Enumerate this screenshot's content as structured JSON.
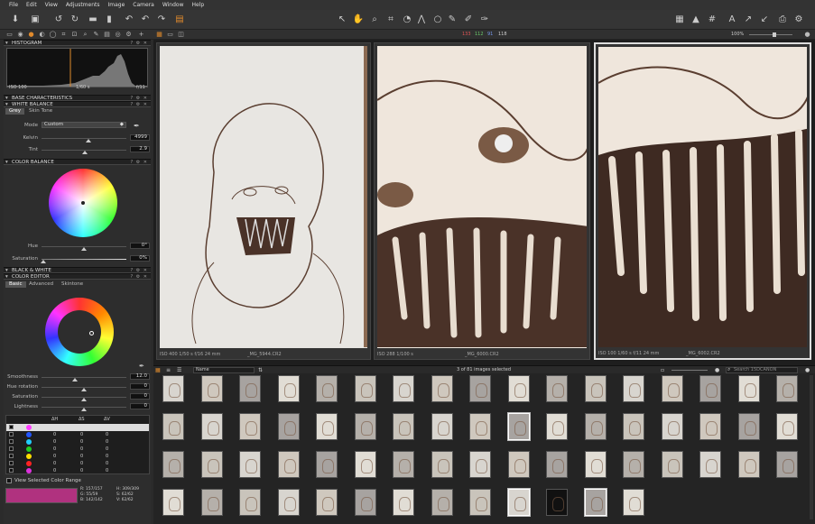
{
  "menu": [
    "File",
    "Edit",
    "View",
    "Adjustments",
    "Image",
    "Camera",
    "Window",
    "Help"
  ],
  "toolstrip": {
    "rgb": [
      "133",
      "112",
      "91",
      "118"
    ],
    "zoom": "100%"
  },
  "histogram": {
    "title": "HISTOGRAM",
    "iso": "ISO 100",
    "shutter": "1/60 s",
    "aperture": "f/11"
  },
  "sections": {
    "base": "BASE CHARACTERISTICS",
    "wb": "WHITE BALANCE",
    "colorbalance": "COLOR BALANCE",
    "bw": "BLACK & WHITE",
    "coloreditor": "COLOR EDITOR"
  },
  "wb": {
    "tabs": [
      "Grey",
      "Skin Tone"
    ],
    "mode_label": "Mode",
    "mode_value": "Custom",
    "kelvin_label": "Kelvin",
    "kelvin_value": "4999",
    "tint_label": "Tint",
    "tint_value": "2.9"
  },
  "colorbalance": {
    "hue_label": "Hue",
    "hue_value": "0°",
    "sat_label": "Saturation",
    "sat_value": "0%"
  },
  "coloreditor": {
    "tabs": [
      "Basic",
      "Advanced",
      "Skintone"
    ],
    "smoothness_label": "Smoothness",
    "smoothness_value": "12.0",
    "huerot_label": "Hue rotation",
    "huerot_value": "0",
    "sat_label": "Saturation",
    "sat_value": "0",
    "light_label": "Lightness",
    "light_value": "0",
    "table_headers": [
      "ΔH",
      "ΔS",
      "ΔV"
    ],
    "rows": [
      {
        "color": "#ff3cff",
        "h": "",
        "s": "",
        "v": ""
      },
      {
        "color": "#2255ff",
        "h": "0",
        "s": "0",
        "v": "0"
      },
      {
        "color": "#22ccff",
        "h": "0",
        "s": "0",
        "v": "0"
      },
      {
        "color": "#22cc22",
        "h": "0",
        "s": "0",
        "v": "0"
      },
      {
        "color": "#ffdd00",
        "h": "0",
        "s": "0",
        "v": "0"
      },
      {
        "color": "#ff2222",
        "h": "0",
        "s": "0",
        "v": "0"
      },
      {
        "color": "#dd33dd",
        "h": "0",
        "s": "0",
        "v": "0"
      }
    ],
    "view_range": "View Selected Color Range",
    "swatch": "#b0327f",
    "readout": {
      "r": "R: 157/157",
      "g": "G: 55/59",
      "b": "B: 142/142",
      "h": "H: 309/309",
      "s": "S: 62/62",
      "v": "V: 62/62"
    }
  },
  "viewer": {
    "panes": [
      {
        "caption": "ISO 400  1/50 s  f/16  24 mm",
        "name": "_MG_5944.CR2",
        "selected": false
      },
      {
        "caption": "ISO 288  1/100 s",
        "name": "_MG_6000.CR2",
        "selected": false
      },
      {
        "caption": "ISO 100  1/60 s  f/11  24 mm",
        "name": "_MG_6002.CR2",
        "selected": true
      }
    ]
  },
  "browser": {
    "sort": "Name",
    "count": "3 of 81 images selected",
    "search_placeholder": "Search 15DCANON"
  }
}
